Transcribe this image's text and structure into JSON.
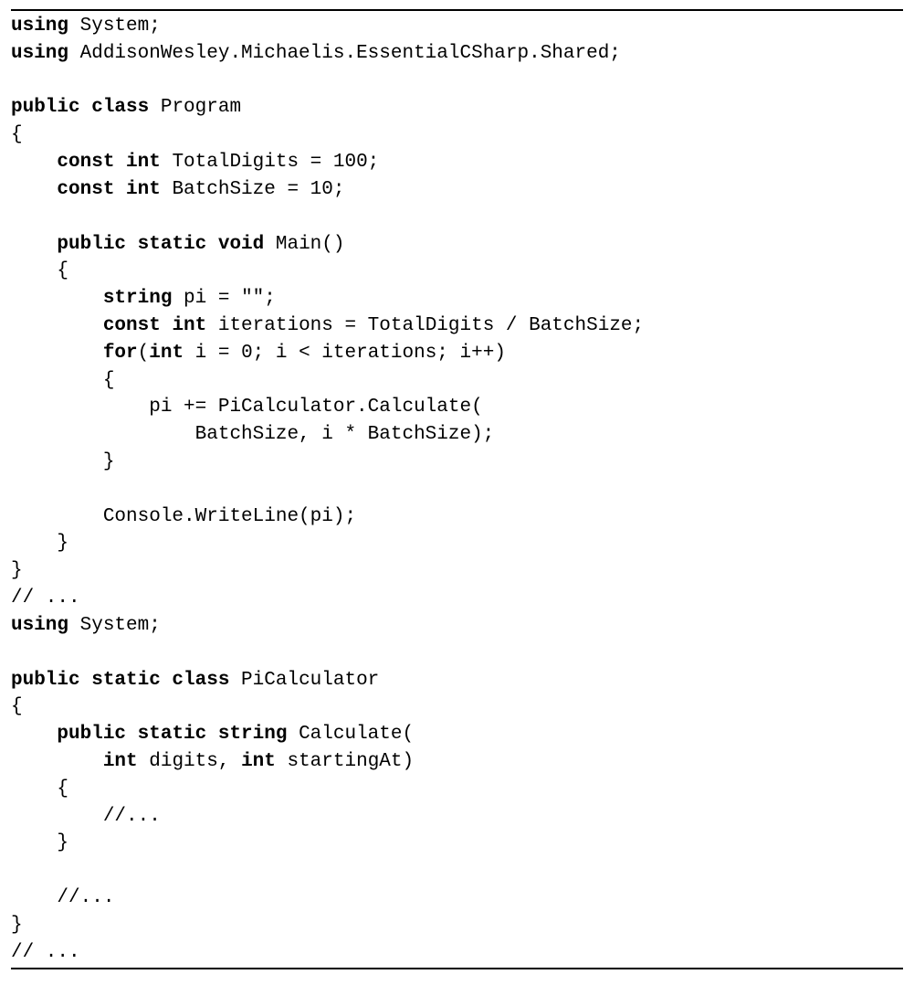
{
  "code": {
    "l1": {
      "k1": "using",
      "t1": " System;"
    },
    "l2": {
      "k1": "using",
      "t1": " AddisonWesley.Michaelis.EssentialCSharp.Shared;"
    },
    "l3": "",
    "l4": {
      "k1": "public class",
      "t1": " Program"
    },
    "l5": "{",
    "l6": {
      "p1": "    ",
      "k1": "const int",
      "t1": " TotalDigits = 100;"
    },
    "l7": {
      "p1": "    ",
      "k1": "const int",
      "t1": " BatchSize = 10;"
    },
    "l8": "",
    "l9": {
      "p1": "    ",
      "k1": "public static void",
      "t1": " Main()"
    },
    "l10": "    {",
    "l11": {
      "p1": "        ",
      "k1": "string",
      "t1": " pi = \"\";"
    },
    "l12": {
      "p1": "        ",
      "k1": "const int",
      "t1": " iterations = TotalDigits / BatchSize;"
    },
    "l13": {
      "p1": "        ",
      "k1": "for",
      "t1": "(",
      "k2": "int",
      "t2": " i = 0; i < iterations; i++)"
    },
    "l14": "        {",
    "l15": "            pi += PiCalculator.Calculate(",
    "l16": "                BatchSize, i * BatchSize);",
    "l17": "        }",
    "l18": "",
    "l19": "        Console.WriteLine(pi);",
    "l20": "    }",
    "l21": "}",
    "l22": "// ...",
    "l23": {
      "k1": "using",
      "t1": " System;"
    },
    "l24": "",
    "l25": {
      "k1": "public static class",
      "t1": " PiCalculator"
    },
    "l26": "{",
    "l27": {
      "p1": "    ",
      "k1": "public static string",
      "t1": " Calculate("
    },
    "l28": {
      "p1": "        ",
      "k1": "int",
      "t1": " digits, ",
      "k2": "int",
      "t2": " startingAt)"
    },
    "l29": "    {",
    "l30": "        //...",
    "l31": "    }",
    "l32": "",
    "l33": "    //...",
    "l34": "}",
    "l35": "// ..."
  }
}
